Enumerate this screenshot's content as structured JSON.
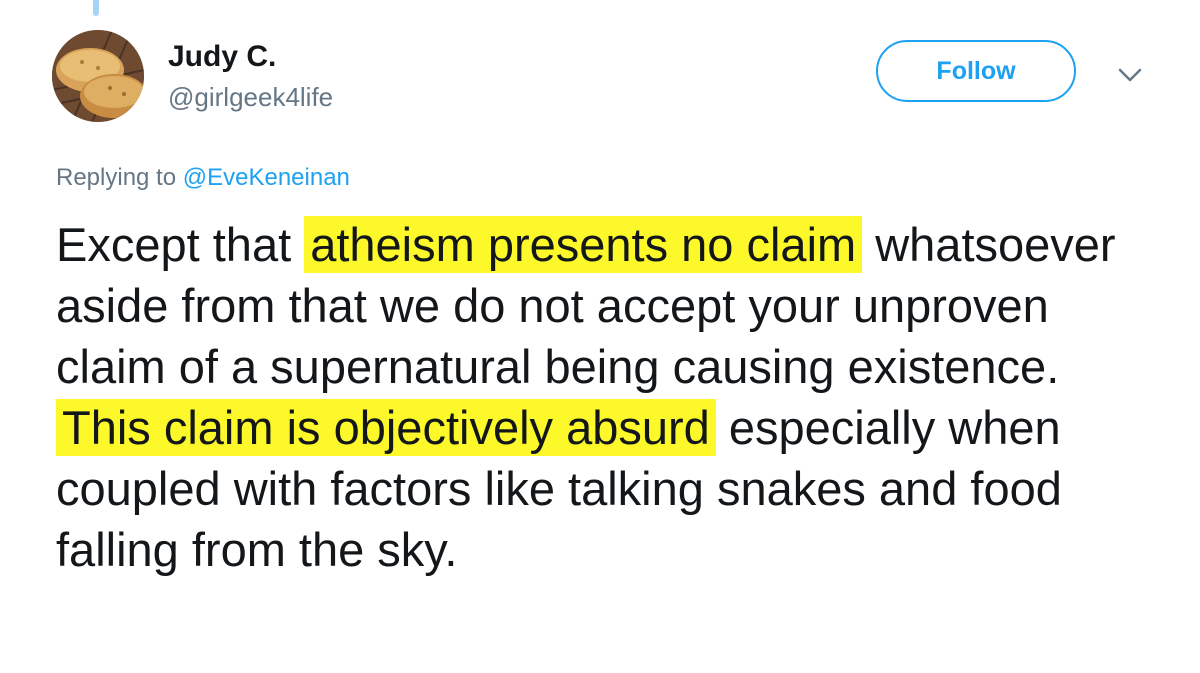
{
  "author": {
    "name": "Judy C.",
    "handle": "@girlgeek4life",
    "avatar_icon": "bread-loaf-avatar"
  },
  "follow": {
    "label": "Follow",
    "color": "#1da1f2"
  },
  "menu": {
    "icon": "chevron-down-icon"
  },
  "reply": {
    "prefix": "Replying to",
    "mention": "@EveKeneinan"
  },
  "tweet": {
    "text_1": "Except that ",
    "highlight_1": "atheism presents no claim",
    "text_2": " whatsoever aside from that we do not accept your unproven claim of a supernatural being causing existence.  ",
    "highlight_2": "This claim is objectively absurd",
    "text_3": " especially when coupled with factors like talking snakes and food falling from the sky.",
    "highlight_color": "#fdf829"
  }
}
